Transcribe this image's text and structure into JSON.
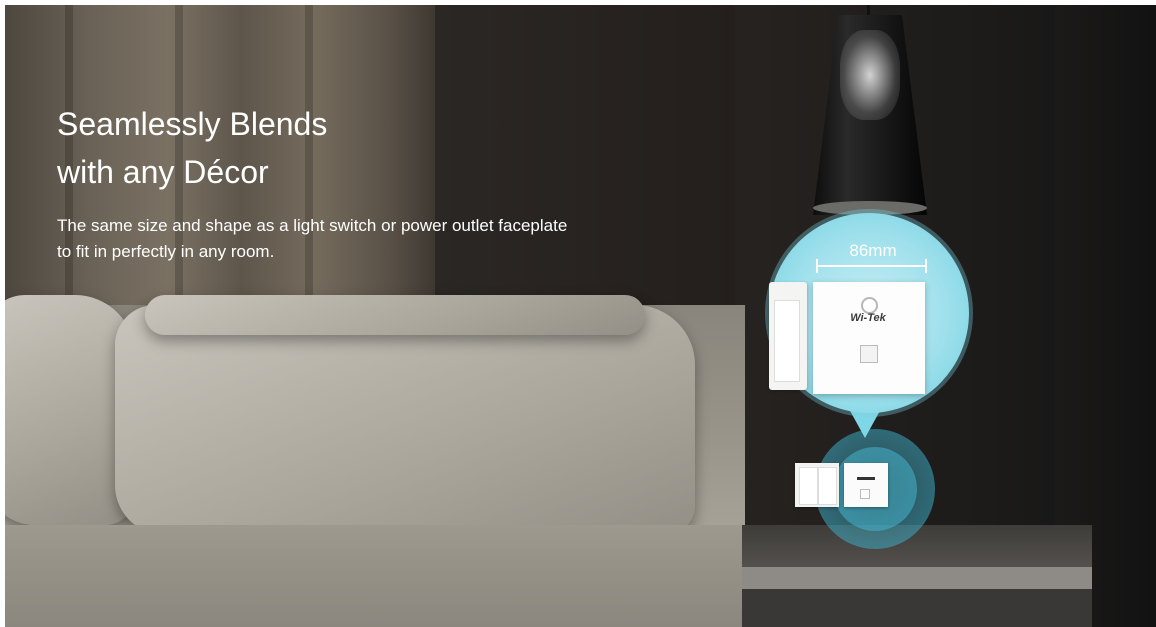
{
  "hero": {
    "headline_line1": "Seamlessly Blends",
    "headline_line2": "with any Décor",
    "description": "The same size and shape as a light switch or power outlet faceplate to fit in perfectly in any room."
  },
  "product_callout": {
    "dimension_label": "86mm",
    "brand_logo": "Wi-Tek",
    "accent_color": "#7fd6e6"
  }
}
